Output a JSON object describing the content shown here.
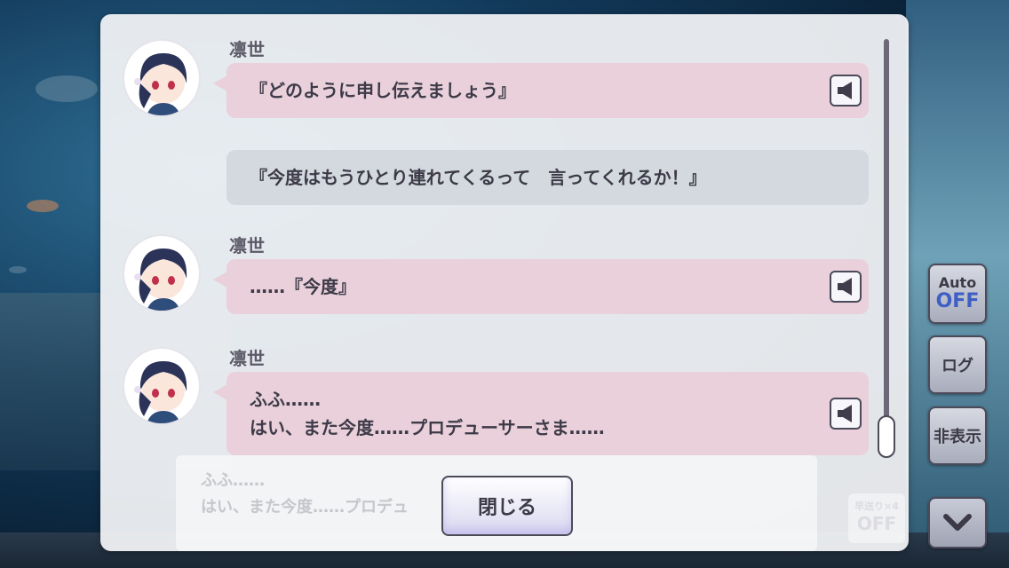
{
  "log": {
    "entries": [
      {
        "speaker": "凛世",
        "lines": [
          "『どのように申し伝えましょう』"
        ],
        "has_voice": true
      },
      {
        "speaker": "",
        "lines": [
          "『今度はもうひとり連れてくるって　言ってくれるか！』"
        ],
        "has_voice": false
      },
      {
        "speaker": "凛世",
        "lines": [
          "……『今度』"
        ],
        "has_voice": true
      },
      {
        "speaker": "凛世",
        "lines": [
          "ふふ……",
          "はい、また今度……プロデューサーさま……"
        ],
        "has_voice": true
      }
    ],
    "close_label": "閉じる"
  },
  "underlay": {
    "lines": [
      "ふふ……",
      "はい、また今度……プロデュ"
    ],
    "skip_label": "早送り×4",
    "skip_value": "OFF"
  },
  "sidebar": {
    "auto_label": "Auto",
    "auto_value": "OFF",
    "log_label": "ログ",
    "hide_label": "非表示"
  },
  "colors": {
    "bubble_pink": "#e9d0da",
    "bubble_gray": "#d3d9df",
    "accent_blue": "#3e5fc4"
  },
  "icons": [
    "speaker-icon",
    "chevron-down-icon"
  ]
}
